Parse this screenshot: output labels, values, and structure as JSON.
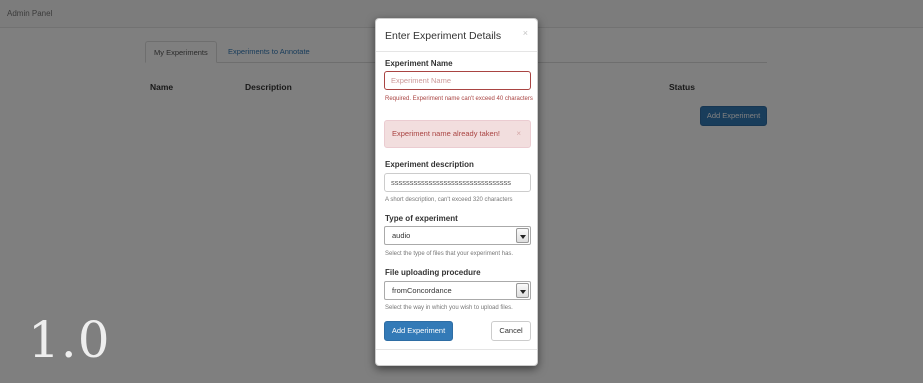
{
  "navbar": {
    "brand": "Admin Panel"
  },
  "tabs": [
    {
      "label": "My Experiments",
      "active": true
    },
    {
      "label": "Experiments to Annotate",
      "active": false
    }
  ],
  "table": {
    "columns": [
      "Name",
      "Description",
      "Status"
    ]
  },
  "background": {
    "add_button": "Add Experiment"
  },
  "version": "1.0",
  "modal": {
    "title": "Enter Experiment Details",
    "close_glyph": "×",
    "name": {
      "label": "Experiment Name",
      "placeholder": "Experiment Name",
      "value": "",
      "error": "Required. Experiment name can't exceed 40 characters"
    },
    "alert": {
      "text": "Experiment name already taken!",
      "close_glyph": "×"
    },
    "description": {
      "label": "Experiment description",
      "value": "ssssssssssssssssssssssssssssssss",
      "help": "A short description, can't exceed 320 characters"
    },
    "type": {
      "label": "Type of experiment",
      "selected": "audio",
      "help": "Select the type of files that your experiment has."
    },
    "upload": {
      "label": "File uploading procedure",
      "selected": "fromConcordance",
      "help": "Select the way in which you wish to upload files."
    },
    "submit_label": "Add Experiment",
    "cancel_label": "Cancel"
  },
  "colors": {
    "primary": "#337ab7",
    "error": "#a94442",
    "alert_bg": "#f2dede"
  }
}
